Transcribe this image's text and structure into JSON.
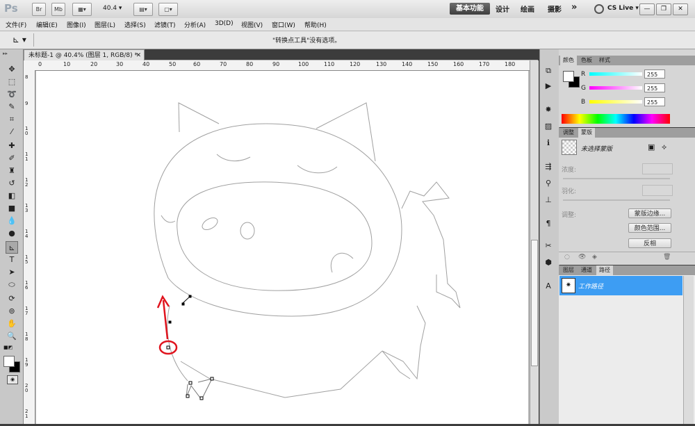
{
  "app": {
    "logo": "Ps",
    "bridge_label": "Br",
    "minibridge_label": "Mb",
    "zoom": "40.4",
    "workspaces": [
      "基本功能",
      "设计",
      "绘画",
      "摄影"
    ],
    "more": "»",
    "cslive": "CS Live"
  },
  "menus": [
    "文件(F)",
    "编辑(E)",
    "图像(I)",
    "图层(L)",
    "选择(S)",
    "滤镜(T)",
    "分析(A)",
    "3D(D)",
    "视图(V)",
    "窗口(W)",
    "帮助(H)"
  ],
  "options": {
    "message": "\"转换点工具\"没有选项。"
  },
  "document": {
    "tab_title": "未标题-1 @ 40.4% (图层 1, RGB/8) *",
    "ruler_h": [
      "0",
      "10",
      "20",
      "30",
      "40",
      "50",
      "60",
      "70",
      "80",
      "90",
      "100",
      "110",
      "120",
      "130",
      "140",
      "150",
      "160",
      "170",
      "180"
    ],
    "ruler_v": [
      "8",
      "9",
      "10",
      "11",
      "12",
      "13",
      "14",
      "15",
      "16",
      "17",
      "18",
      "19",
      "20",
      "21"
    ]
  },
  "color_panel": {
    "tabs": [
      "颜色",
      "色板",
      "样式"
    ],
    "channels": [
      {
        "name": "R",
        "value": "255",
        "color": "#ff3b3b"
      },
      {
        "name": "G",
        "value": "255",
        "color": "#34d64a"
      },
      {
        "name": "B",
        "value": "255",
        "color": "#3b6cff"
      }
    ]
  },
  "masks_panel": {
    "tabs": [
      "调整",
      "蒙版"
    ],
    "no_mask": "未选择蒙版",
    "density": "浓度:",
    "feather": "羽化:",
    "refine": "调整:",
    "buttons": [
      "蒙版边缘...",
      "颜色范围...",
      "反相"
    ]
  },
  "paths_panel": {
    "tabs": [
      "图层",
      "通道",
      "路径"
    ],
    "item": "工作路径",
    "highlight_color": "#3d9df3"
  },
  "colors": {
    "annotation_red": "#e0141e"
  }
}
